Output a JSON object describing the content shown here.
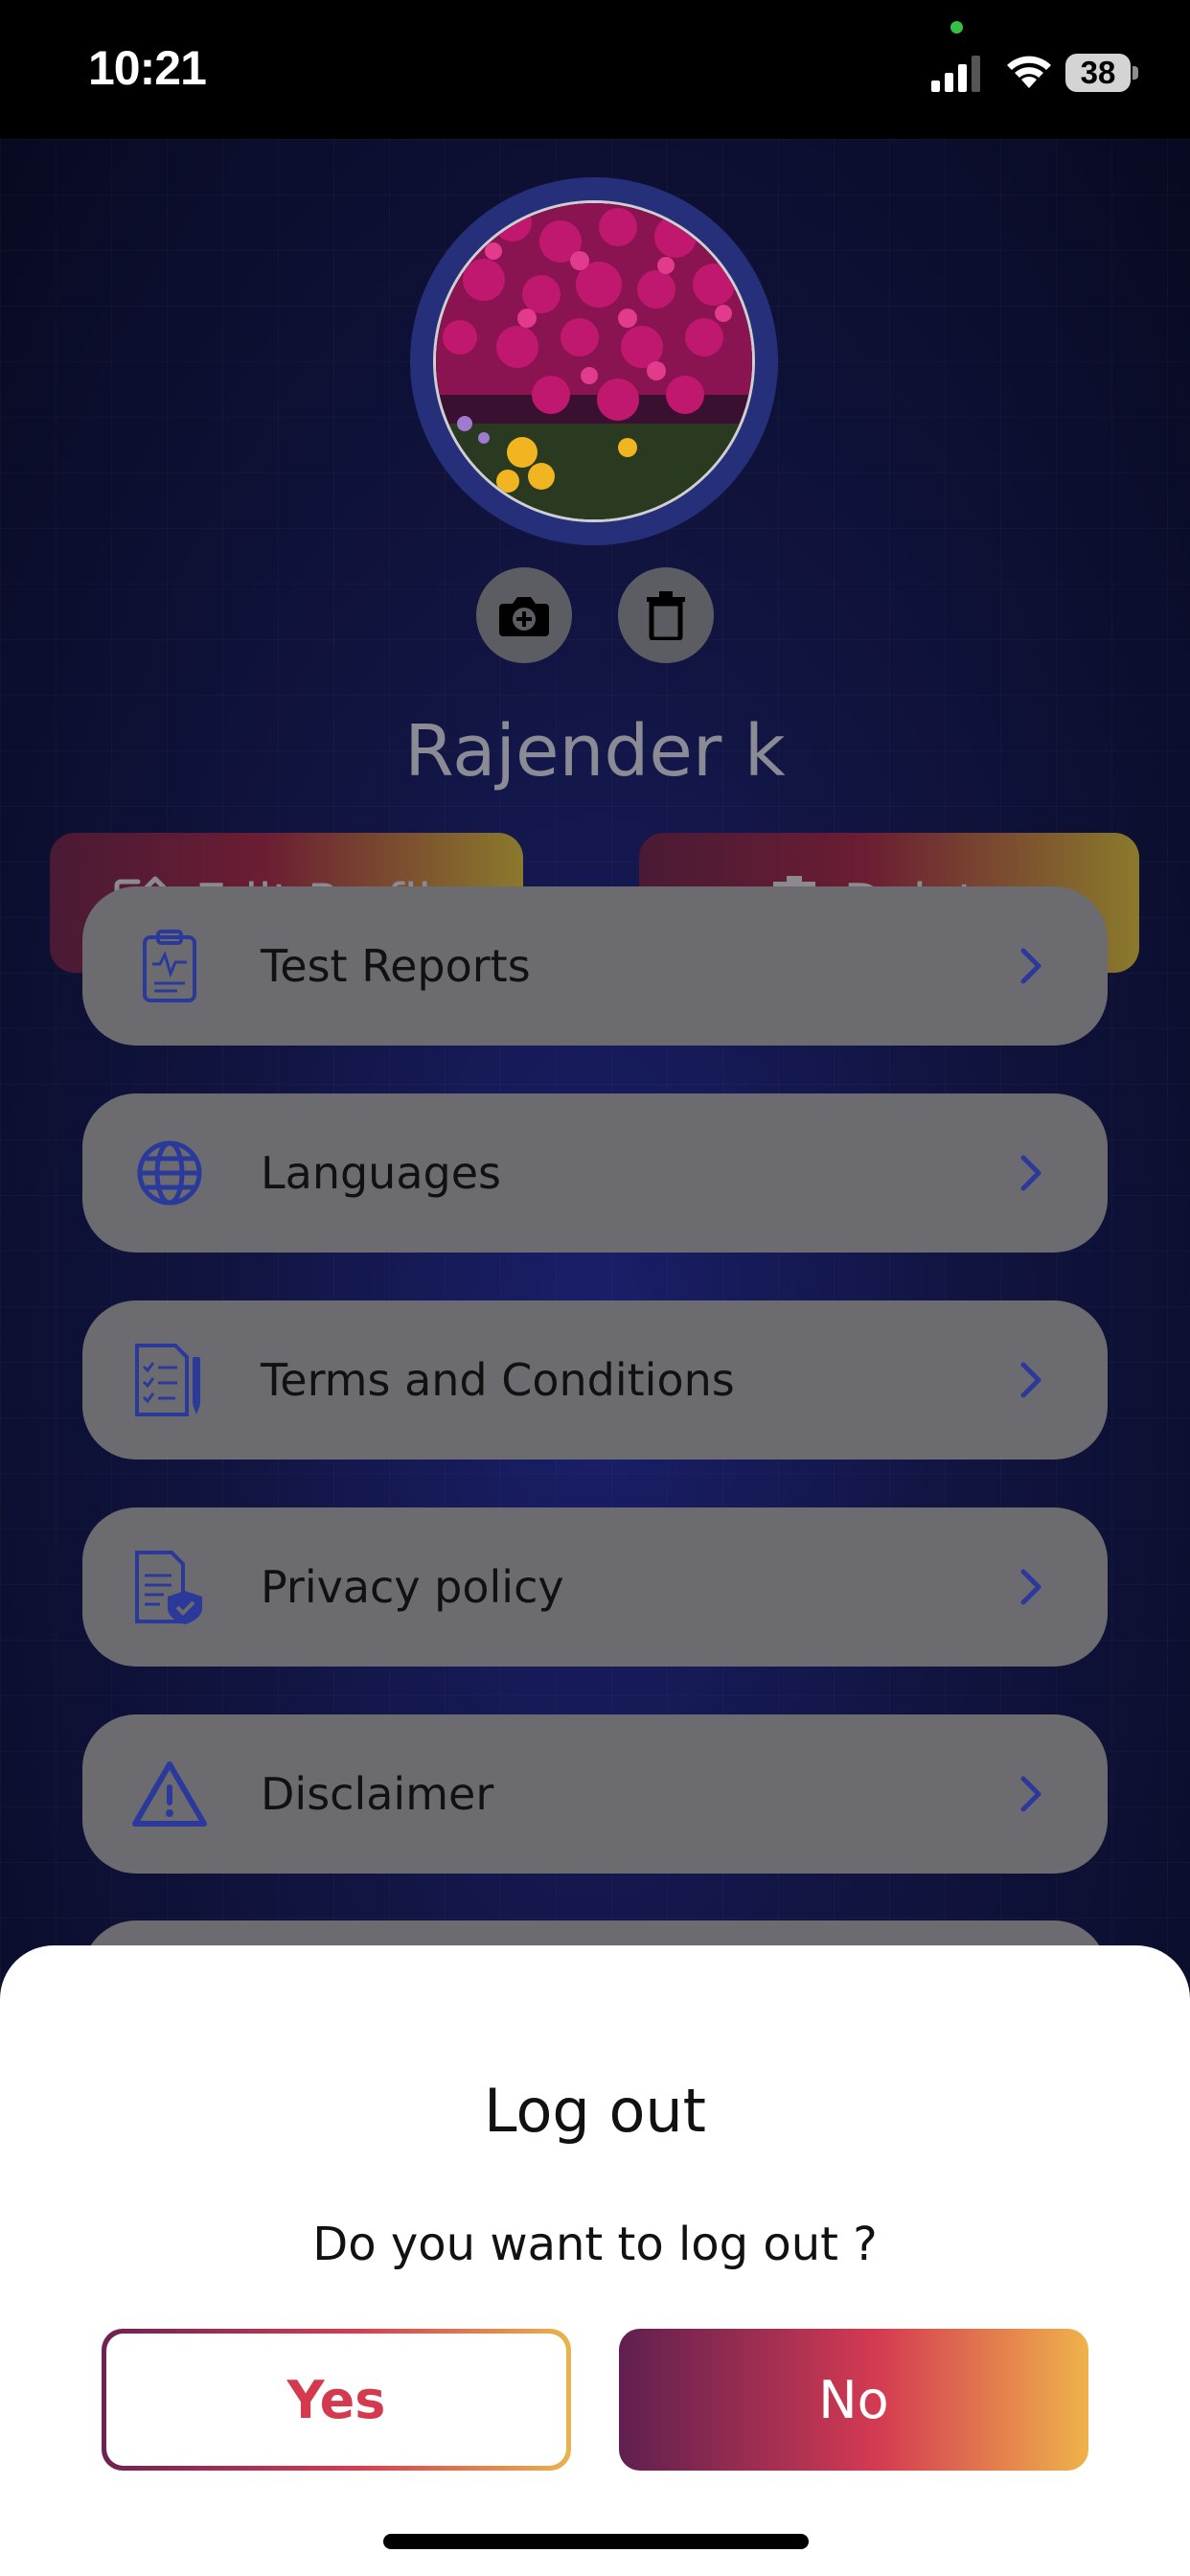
{
  "status_bar": {
    "time": "10:21",
    "battery": "38"
  },
  "profile": {
    "name": "Rajender k",
    "edit_label": "Edit Profile",
    "delete_label": "Delete"
  },
  "menu": {
    "items": [
      {
        "label": "Test Reports",
        "icon": "clipboard-report-icon"
      },
      {
        "label": "Languages",
        "icon": "globe-icon"
      },
      {
        "label": "Terms and Conditions",
        "icon": "checklist-document-icon"
      },
      {
        "label": "Privacy policy",
        "icon": "document-shield-icon"
      },
      {
        "label": "Disclaimer",
        "icon": "warning-triangle-icon"
      }
    ]
  },
  "logout_sheet": {
    "title": "Log out",
    "message": "Do you want to log out ?",
    "yes_label": "Yes",
    "no_label": "No"
  },
  "colors": {
    "menu_icon": "#2b3a9a",
    "accent_start": "#6e2155",
    "accent_mid": "#d43e52",
    "accent_end": "#e8b44c"
  }
}
